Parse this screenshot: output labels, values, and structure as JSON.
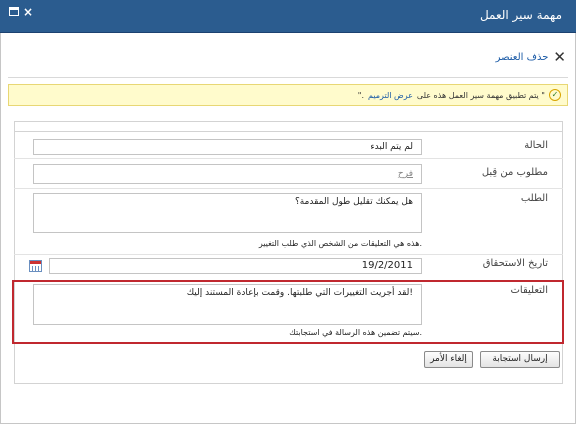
{
  "window": {
    "title": "مهمة سير العمل",
    "close_glyph": "×"
  },
  "ribbon": {
    "delete_label": "حذف العنصر"
  },
  "status": {
    "prefix": "يتم تطبيق مهمة سير العمل هذه على \"",
    "link": "عرض الترميم",
    "suffix": "\"."
  },
  "form": {
    "status": {
      "label": "الحالة",
      "value": "لم يتم البدء"
    },
    "requested_from": {
      "label": "مطلوب من قِبل",
      "placeholder": "فرح"
    },
    "request": {
      "label": "الطلب",
      "value": "هل يمكنك تقليل طول المقدمة؟",
      "hint": "هذه هي التعليقات من الشخص الذي طلب التغيير."
    },
    "due_date": {
      "label": "تاريخ الاستحقاق",
      "value": "19/2/2011"
    },
    "comments": {
      "label": "التعليقات",
      "value": "لقد أجريت التغييرات التي طلبتها. وقمت بإعادة المستند إليك!",
      "hint": "سيتم تضمين هذه الرسالة في استجابتك."
    }
  },
  "buttons": {
    "send_response": "إرسال استجابة",
    "cancel": "إلغاء الأمر"
  },
  "colors": {
    "titlebar": "#2b5c8f",
    "highlight_border": "#c0282f",
    "status_bg": "#fffbcc"
  }
}
